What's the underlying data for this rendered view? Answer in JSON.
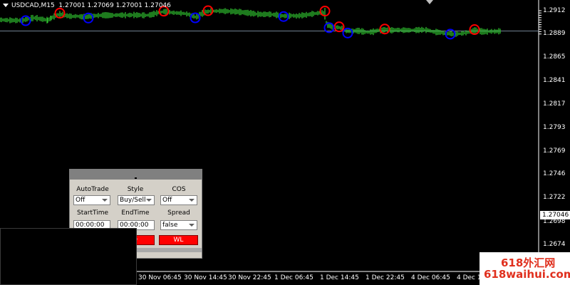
{
  "header": {
    "symbol_timeframe": "USDCAD,M15",
    "ohlc": "1.27001 1.27069 1.27001 1.27046"
  },
  "price_axis": {
    "labels": [
      "1.2912",
      "1.2889",
      "1.2865",
      "1.2841",
      "1.2817",
      "1.2793",
      "1.2769",
      "1.2746",
      "1.2722",
      "1.2698",
      "1.2674"
    ],
    "current": "1.27046"
  },
  "time_axis": {
    "labels": [
      "4",
      "30 Nov 06:45",
      "30 Nov 14:45",
      "30 Nov 22:45",
      "1 Dec 06:45",
      "1 Dec 14:45",
      "1 Dec 22:45",
      "4 Dec 06:45",
      "4 Dec 1"
    ]
  },
  "colors": {
    "background": "#000000",
    "candle": "#32cd32",
    "peak_marker": "#ff0000",
    "trough_marker": "#0000ff",
    "current_line": "#708090"
  },
  "panel": {
    "autotrade_label": "AutoTrade",
    "style_label": "Style",
    "cos_label": "COS",
    "autotrade_value": "Off",
    "style_value": "Buy/Sell",
    "cos_value": "Off",
    "starttime_label": "StartTime",
    "endtime_label": "EndTime",
    "spread_label": "Spread",
    "starttime_value": "00:00:00",
    "endtime_value": "00:00:00",
    "spread_value": "false",
    "button_left": "D",
    "button_right": "WL"
  },
  "watermark": {
    "line1": "618外汇网",
    "line2": "618waihui.com"
  },
  "price_series": [
    [
      0,
      1.2819
    ],
    [
      8,
      1.2816
    ],
    [
      18,
      1.2813
    ],
    [
      26,
      1.2812
    ],
    [
      32,
      1.2814
    ],
    [
      38,
      1.2826
    ],
    [
      44,
      1.2836
    ],
    [
      50,
      1.2838
    ],
    [
      56,
      1.2829
    ],
    [
      62,
      1.2822
    ],
    [
      67,
      1.2814
    ],
    [
      72,
      1.2838
    ],
    [
      78,
      1.286
    ],
    [
      84,
      1.2876
    ],
    [
      90,
      1.2866
    ],
    [
      96,
      1.2858
    ],
    [
      102,
      1.2853
    ],
    [
      108,
      1.2857
    ],
    [
      114,
      1.285
    ],
    [
      120,
      1.2846
    ],
    [
      128,
      1.2858
    ],
    [
      136,
      1.2862
    ],
    [
      146,
      1.2866
    ],
    [
      156,
      1.2864
    ],
    [
      166,
      1.2868
    ],
    [
      176,
      1.2866
    ],
    [
      186,
      1.2868
    ],
    [
      196,
      1.2867
    ],
    [
      204,
      1.2864
    ],
    [
      212,
      1.287
    ],
    [
      218,
      1.2884
    ],
    [
      224,
      1.2894
    ],
    [
      230,
      1.2903
    ],
    [
      236,
      1.2898
    ],
    [
      242,
      1.2892
    ],
    [
      250,
      1.2888
    ],
    [
      258,
      1.2884
    ],
    [
      264,
      1.2876
    ],
    [
      270,
      1.2863
    ],
    [
      274,
      1.2848
    ],
    [
      278,
      1.2856
    ],
    [
      282,
      1.2878
    ],
    [
      288,
      1.2898
    ],
    [
      294,
      1.2906
    ],
    [
      300,
      1.2908
    ],
    [
      310,
      1.2909
    ],
    [
      320,
      1.2906
    ],
    [
      330,
      1.2903
    ],
    [
      340,
      1.2896
    ],
    [
      350,
      1.2888
    ],
    [
      360,
      1.2878
    ],
    [
      368,
      1.2874
    ],
    [
      376,
      1.2876
    ],
    [
      384,
      1.2872
    ],
    [
      392,
      1.2866
    ],
    [
      398,
      1.2859
    ],
    [
      404,
      1.2857
    ],
    [
      410,
      1.2863
    ],
    [
      416,
      1.2857
    ],
    [
      422,
      1.2863
    ],
    [
      430,
      1.2869
    ],
    [
      438,
      1.2879
    ],
    [
      446,
      1.2887
    ],
    [
      452,
      1.2893
    ],
    [
      456,
      1.2881
    ],
    [
      458,
      1.2785
    ],
    [
      460,
      1.2767
    ],
    [
      464,
      1.2754
    ],
    [
      468,
      1.2748
    ],
    [
      472,
      1.2744
    ],
    [
      476,
      1.274
    ],
    [
      480,
      1.2728
    ],
    [
      484,
      1.271
    ],
    [
      488,
      1.2703
    ],
    [
      494,
      1.2701
    ],
    [
      500,
      1.2708
    ],
    [
      506,
      1.2704
    ],
    [
      512,
      1.2694
    ],
    [
      518,
      1.2693
    ],
    [
      524,
      1.2697
    ],
    [
      530,
      1.271
    ],
    [
      536,
      1.2713
    ],
    [
      542,
      1.2719
    ],
    [
      548,
      1.2711
    ],
    [
      556,
      1.2715
    ],
    [
      566,
      1.2713
    ],
    [
      576,
      1.2712
    ],
    [
      586,
      1.2714
    ],
    [
      594,
      1.2717
    ],
    [
      600,
      1.2713
    ],
    [
      604,
      1.2706
    ],
    [
      608,
      1.2697
    ],
    [
      614,
      1.2693
    ],
    [
      620,
      1.2688
    ],
    [
      626,
      1.2677
    ],
    [
      632,
      1.2679
    ],
    [
      638,
      1.2668
    ],
    [
      642,
      1.2676
    ],
    [
      646,
      1.2677
    ],
    [
      650,
      1.2682
    ],
    [
      654,
      1.2686
    ],
    [
      658,
      1.2693
    ],
    [
      662,
      1.2703
    ],
    [
      666,
      1.2711
    ],
    [
      670,
      1.2712
    ],
    [
      674,
      1.2703
    ],
    [
      678,
      1.2697
    ],
    [
      684,
      1.2698
    ],
    [
      690,
      1.2701
    ],
    [
      696,
      1.27
    ],
    [
      702,
      1.2703
    ],
    [
      704,
      1.2705
    ]
  ],
  "peak_markers": [
    [
      84,
      1.2887
    ],
    [
      230,
      1.2907
    ],
    [
      292,
      1.2912
    ],
    [
      456,
      1.2908
    ],
    [
      476,
      1.2747
    ],
    [
      540,
      1.2725
    ],
    [
      666,
      1.2719
    ]
  ],
  "trough_markers": [
    [
      36,
      1.281
    ],
    [
      124,
      1.2837
    ],
    [
      274,
      1.2839
    ],
    [
      398,
      1.2852
    ],
    [
      462,
      1.2738
    ],
    [
      488,
      1.2684
    ],
    [
      632,
      1.2673
    ]
  ]
}
